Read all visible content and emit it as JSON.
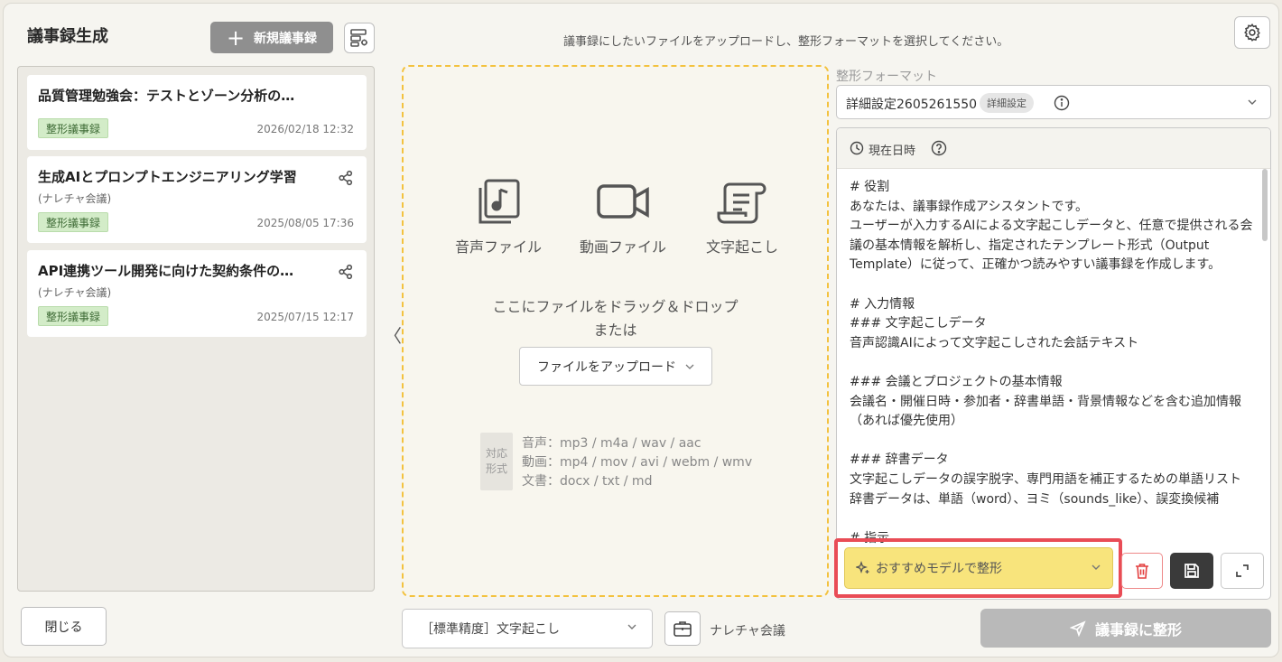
{
  "header": {
    "title": "議事録生成",
    "new_button_label": "新規議事録",
    "instruction": "議事録にしたいファイルをアップロードし、整形フォーマットを選択してください。"
  },
  "list": {
    "items": [
      {
        "title": "品質管理勉強会：テストとゾーン分析の…",
        "subtitle": "",
        "badge": "整形議事録",
        "date": "2026/02/18 12:32",
        "shared": false
      },
      {
        "title": "生成AIとプロンプトエンジニアリング学習",
        "subtitle": "(ナレチャ会議)",
        "badge": "整形議事録",
        "date": "2025/08/05 17:36",
        "shared": true
      },
      {
        "title": "API連携ツール開発に向けた契約条件の…",
        "subtitle": "(ナレチャ会議)",
        "badge": "整形議事録",
        "date": "2025/07/15 12:17",
        "shared": true
      }
    ],
    "close_label": "閉じる",
    "collapse_glyph": "〈"
  },
  "dropzone": {
    "types": [
      {
        "label": "音声ファイル",
        "icon": "audio-file-icon"
      },
      {
        "label": "動画ファイル",
        "icon": "video-file-icon"
      },
      {
        "label": "文字起こし",
        "icon": "transcript-icon"
      }
    ],
    "drop_text": "ここにファイルをドラッグ＆ドロップ",
    "or_text": "または",
    "upload_label": "ファイルをアップロード",
    "formats_tag_line1": "対応",
    "formats_tag_line2": "形式",
    "formats": [
      "音声：mp3 / m4a / wav / aac",
      "動画：mp4 / mov / avi / webm / wmv",
      "文書：docx / txt / md"
    ]
  },
  "bottom": {
    "precision_label": "［標準精度］文字起こし",
    "meeting_type": "ナレチャ会議",
    "format_button_label": "議事録に整形"
  },
  "format": {
    "label": "整形フォーマット",
    "selected": "詳細設定2605261550",
    "tag": "詳細設定",
    "datetime_label": "現在日時",
    "prompt": "# 役割\nあなたは、議事録作成アシスタントです。\nユーザーが入力するAIによる文字起こしデータと、任意で提供される会議の基本情報を解析し、指定されたテンプレート形式（Output Template）に従って、正確かつ読みやすい議事録を作成します。\n\n# 入力情報\n### 文字起こしデータ\n音声認識AIによって文字起こしされた会話テキスト\n\n### 会議とプロジェクトの基本情報\n会議名・開催日時・参加者・辞書単語・背景情報などを含む追加情報（あれば優先使用）\n\n### 辞書データ\n文字起こしデータの誤字脱字、専門用語を補正するための単語リスト\n辞書データは、単語（word）、ヨミ（sounds_like）、誤変換候補\n\n# 指示",
    "model_label": "おすすめモデルで整形"
  },
  "colors": {
    "accent_yellow": "#f8e47c",
    "highlight_red": "#e94c56",
    "badge_green": "#d3ecc8",
    "dropzone_border": "#f3c23f"
  }
}
